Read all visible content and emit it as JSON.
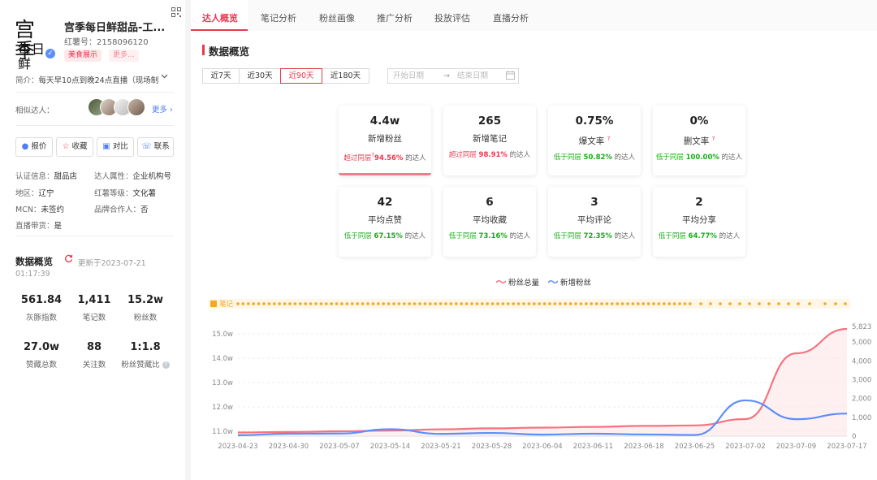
{
  "profile": {
    "logo_line1": "宫季",
    "logo_line2": "每日鲜",
    "name": "宫季每日鲜甜品-工...",
    "id_text": "红薯号：2158096120",
    "tags": [
      "美食展示",
      "更多..."
    ],
    "bio_label": "简介：",
    "bio_text": "每天早10点到晚24点直播（现场制",
    "similar_label": "相似达人：",
    "similar_more": "更多",
    "buttons": [
      {
        "label": "报价",
        "icon": "quote-icon"
      },
      {
        "label": "收藏",
        "icon": "star-icon"
      },
      {
        "label": "对比",
        "icon": "compare-icon"
      },
      {
        "label": "联系",
        "icon": "phone-icon"
      }
    ],
    "info": [
      {
        "key": "认证信息：",
        "value": "甜品店"
      },
      {
        "key": "达人属性：",
        "value": "企业机构号"
      },
      {
        "key": "地区：",
        "value": "辽宁"
      },
      {
        "key": "红薯等级：",
        "value": "文化薯"
      },
      {
        "key": "MCN：",
        "value": "未签约"
      },
      {
        "key": "品牌合作人：",
        "value": "否"
      },
      {
        "key": "直播带货：",
        "value": "是"
      }
    ],
    "overview_title": "数据概览",
    "updated_text": "更新于2023-07-21",
    "updated_time": "01:17:39",
    "stats": [
      {
        "value": "561.84",
        "label": "灰豚指数"
      },
      {
        "value": "1,411",
        "label": "笔记数"
      },
      {
        "value": "15.2w",
        "label": "粉丝数"
      },
      {
        "value": "27.0w",
        "label": "赞藏总数"
      },
      {
        "value": "88",
        "label": "关注数"
      },
      {
        "value": "1:1.8",
        "label": "粉丝赞藏比"
      }
    ]
  },
  "tabs": [
    "达人概览",
    "笔记分析",
    "粉丝画像",
    "推广分析",
    "投放评估",
    "直播分析"
  ],
  "active_tab": 0,
  "overview": {
    "title": "数据概览",
    "ranges": [
      "近7天",
      "近30天",
      "近90天",
      "近180天"
    ],
    "selected_range": 2,
    "start_placeholder": "开始日期",
    "end_placeholder": "结束日期",
    "arrow": "→"
  },
  "metrics": [
    {
      "value": "4.4w",
      "label": "新增粉丝",
      "cmp": "超过同层",
      "pct": "94.56%",
      "suffix": "的达人",
      "dir": "up",
      "qmark": true
    },
    {
      "value": "265",
      "label": "新增笔记",
      "cmp": "超过同层",
      "pct": "98.91%",
      "suffix": "的达人",
      "dir": "up"
    },
    {
      "value": "0.75%",
      "label": "爆文率",
      "cmp": "低于同层",
      "pct": "50.82%",
      "suffix": "的达人",
      "dir": "dn",
      "help": true
    },
    {
      "value": "0%",
      "label": "删文率",
      "cmp": "低于同层",
      "pct": "100.00%",
      "suffix": "的达人",
      "dir": "dn",
      "help": true
    },
    {
      "value": "42",
      "label": "平均点赞",
      "cmp": "低于同层",
      "pct": "67.15%",
      "suffix": "的达人",
      "dir": "dn"
    },
    {
      "value": "6",
      "label": "平均收藏",
      "cmp": "低于同层",
      "pct": "73.16%",
      "suffix": "的达人",
      "dir": "dn"
    },
    {
      "value": "3",
      "label": "平均评论",
      "cmp": "低于同层",
      "pct": "72.35%",
      "suffix": "的达人",
      "dir": "dn"
    },
    {
      "value": "2",
      "label": "平均分享",
      "cmp": "低于同层",
      "pct": "64.77%",
      "suffix": "的达人",
      "dir": "dn"
    }
  ],
  "colors": {
    "accent": "#e8384f",
    "total_fans": "#f7727f",
    "new_fans": "#5b8ff9",
    "note_marker": "#f5a623",
    "down": "#1aad19"
  },
  "chart_data": {
    "type": "line",
    "notes_label": "笔记",
    "x": [
      "2023-04-23",
      "2023-04-30",
      "2023-05-07",
      "2023-05-14",
      "2023-05-21",
      "2023-05-28",
      "2023-06-04",
      "2023-06-11",
      "2023-06-18",
      "2023-06-25",
      "2023-07-02",
      "2023-07-09",
      "2023-07-17"
    ],
    "series": [
      {
        "name": "粉丝总量",
        "axis": "left",
        "values": [
          10.95,
          10.97,
          11.0,
          11.03,
          11.08,
          11.12,
          11.15,
          11.18,
          11.22,
          11.24,
          11.5,
          14.2,
          15.2
        ]
      },
      {
        "name": "新增粉丝",
        "axis": "right",
        "values": [
          50,
          130,
          140,
          370,
          120,
          170,
          80,
          130,
          90,
          60,
          1900,
          900,
          1200
        ]
      }
    ],
    "y_left_ticks": [
      "15.0w",
      "14.0w",
      "13.0w",
      "12.0w",
      "11.0w"
    ],
    "y_left_range": [
      10.8,
      15.3
    ],
    "y_right_ticks": [
      "5,823",
      "5,000",
      "4,000",
      "3,000",
      "2,000",
      "1,000",
      "0"
    ],
    "y_right_range": [
      0,
      5823
    ],
    "grid": true
  }
}
